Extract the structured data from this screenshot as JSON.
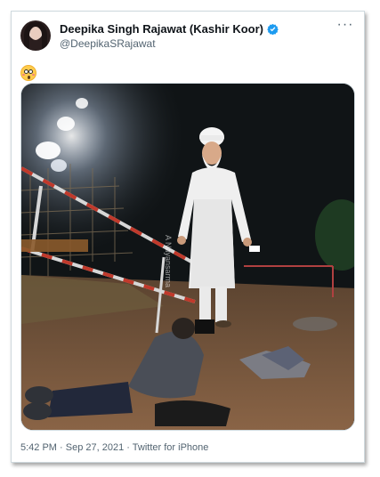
{
  "tweet": {
    "author_name": "Deepika Singh Rajawat (Kashir Koor)",
    "author_handle": "@DeepikaSRajawat",
    "verified": true,
    "more_icon": "more-options-icon",
    "text_emoji": "flushed-face",
    "media_watermark": "A Nayansarma",
    "timestamp": "5:42 PM · Sep 27, 2021",
    "source": "Twitter for iPhone",
    "verified_color": "#1d9bf0"
  }
}
